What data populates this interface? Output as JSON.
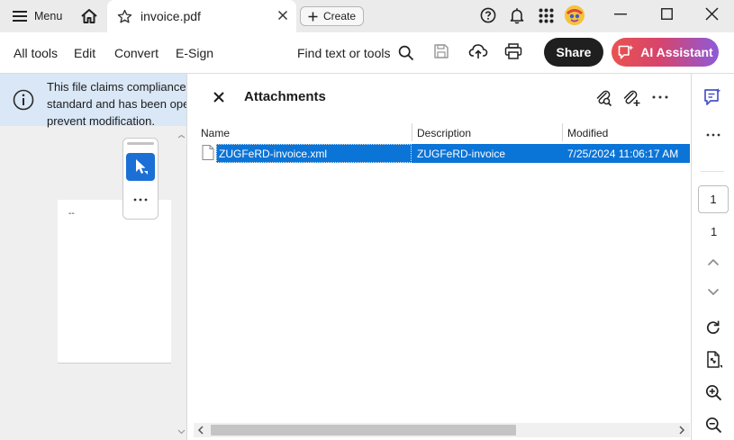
{
  "titlebar": {
    "menu_label": "Menu",
    "tab_title": "invoice.pdf",
    "create_label": "Create"
  },
  "toolbar": {
    "menus": [
      "All tools",
      "Edit",
      "Convert",
      "E-Sign"
    ],
    "find_label": "Find text or tools",
    "share_label": "Share",
    "ai_label": "AI Assistant"
  },
  "banner": {
    "lines": [
      "This file claims compliance with the PDF/A standard",
      "standard and has been opened read-only to",
      "prevent modification."
    ]
  },
  "page_preview": {
    "dots": "--"
  },
  "attachments": {
    "title": "Attachments",
    "columns": [
      "Name",
      "Description",
      "Modified"
    ],
    "rows": [
      {
        "name": "ZUGFeRD-invoice.xml",
        "description": "ZUGFeRD-invoice",
        "modified": "7/25/2024 11:06:17 AM",
        "selected": true
      }
    ]
  },
  "right_rail": {
    "current_page": "1",
    "total_pages": "1"
  },
  "colors": {
    "selection": "#0b74d7",
    "banner_bg": "#d9e7f6",
    "share_bg": "#1f1f1f",
    "ai_gradient_start": "#e9534f",
    "ai_gradient_end": "#8d5ad9",
    "select_tool_bg": "#1c6fd4",
    "rail_accent": "#4a53c9"
  },
  "icons": [
    "hamburger-icon",
    "home-icon",
    "star-icon",
    "close-icon",
    "plus-icon",
    "help-icon",
    "bell-icon",
    "apps-grid-icon",
    "avatar",
    "minimize-icon",
    "maximize-icon",
    "search-icon",
    "save-icon",
    "cloud-upload-icon",
    "print-icon",
    "ai-sparkle-icon",
    "info-icon",
    "cursor-select-icon",
    "more-icon",
    "attachment-search-icon",
    "attachment-add-icon",
    "file-icon",
    "comment-icon",
    "chevron-up-icon",
    "chevron-down-icon",
    "rotate-icon",
    "fit-page-icon",
    "zoom-in-icon",
    "zoom-out-icon"
  ]
}
